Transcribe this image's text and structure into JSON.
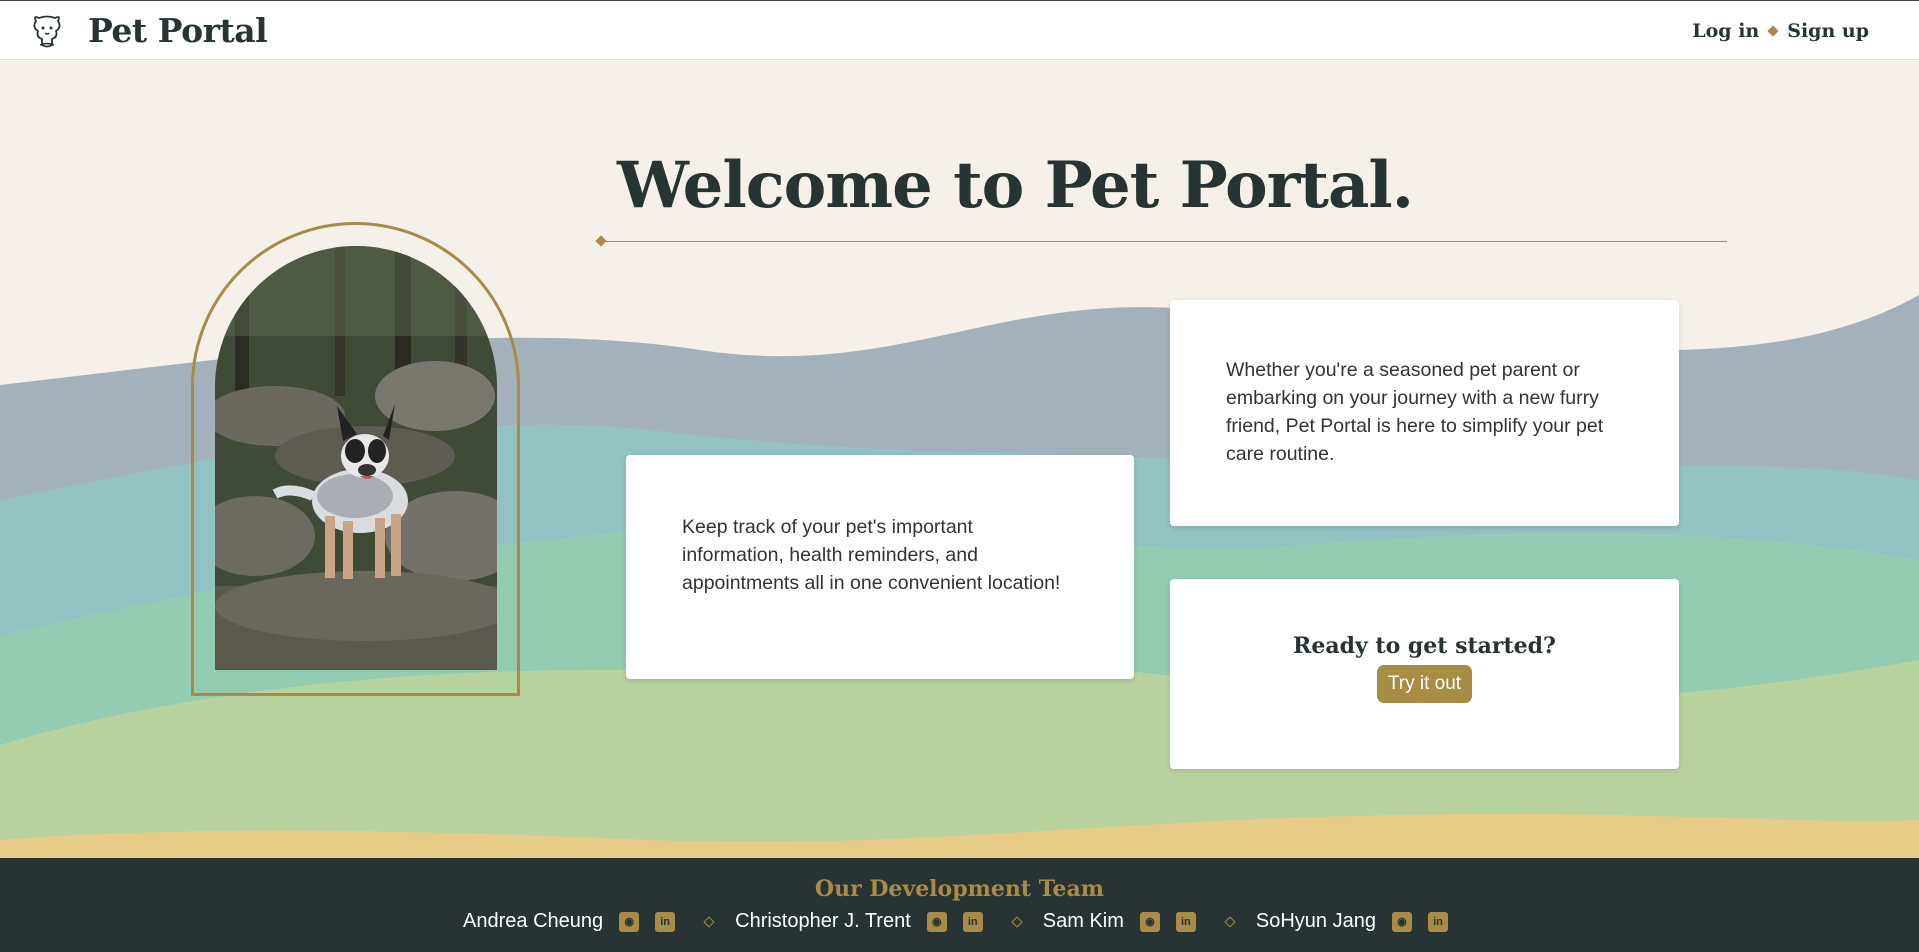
{
  "header": {
    "brand": "Pet Portal",
    "login_label": "Log in",
    "signup_label": "Sign up",
    "logo_icon": "dog-cat-logo-icon"
  },
  "hero": {
    "title": "Welcome to Pet Portal.",
    "card_left_text": "Keep track of your pet's important information, health reminders, and appointments all in one convenient location!",
    "card_right_text": "Whether you're a seasoned pet parent or embarking on your journey with a new furry friend, Pet Portal is here to simplify your pet care routine.",
    "cta_heading": "Ready to get started?",
    "cta_button": "Try it out"
  },
  "footer": {
    "title": "Our Development Team",
    "members": [
      {
        "name": "Andrea Cheung"
      },
      {
        "name": "Christopher J. Trent"
      },
      {
        "name": "Sam Kim"
      },
      {
        "name": "SoHyun Jang"
      }
    ]
  },
  "colors": {
    "accent": "#a88b45",
    "dark": "#283334",
    "background": "#f5f0ea",
    "wave_gray": "#a4b1bb",
    "wave_teal": "#93c2c3",
    "wave_green": "#94cbb3",
    "wave_lime": "#b8d29e",
    "wave_sand": "#e8cb86"
  }
}
